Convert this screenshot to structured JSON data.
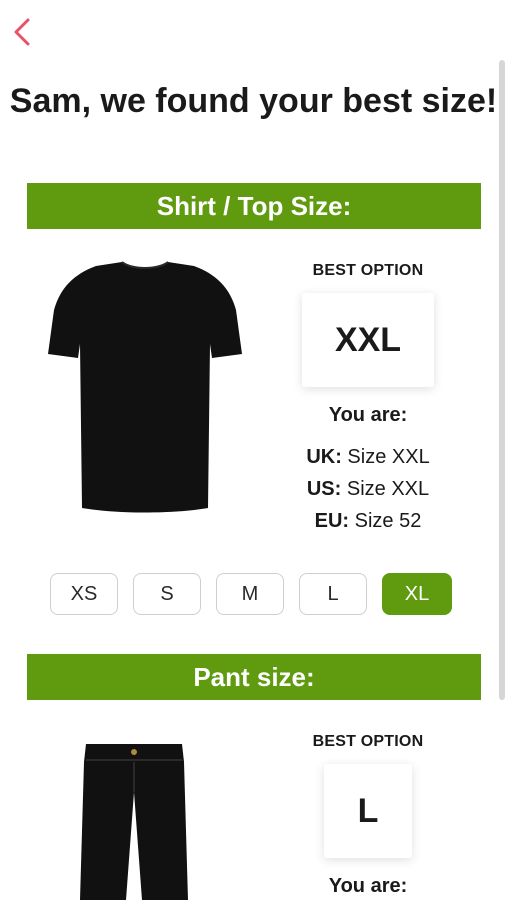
{
  "header": {
    "back_icon": "chevron-left-icon",
    "back_color": "#e8506b"
  },
  "title": "Sam, we found your best size!",
  "shirt": {
    "section_label": "Shirt / Top Size:",
    "image_icon": "tshirt-icon",
    "best_option_label": "BEST OPTION",
    "best_size": "XXL",
    "you_are_label": "You are:",
    "conversions": [
      {
        "region": "UK:",
        "value": "Size XXL"
      },
      {
        "region": "US:",
        "value": "Size XXL"
      },
      {
        "region": "EU:",
        "value": "Size 52"
      }
    ],
    "size_options": [
      "XS",
      "S",
      "M",
      "L",
      "XL"
    ],
    "selected_size": "XL"
  },
  "pants": {
    "section_label": "Pant size:",
    "image_icon": "pants-icon",
    "best_option_label": "BEST OPTION",
    "best_size": "L",
    "you_are_label": "You are:"
  },
  "colors": {
    "accent": "#5f9a0f",
    "back_arrow": "#e8506b"
  }
}
